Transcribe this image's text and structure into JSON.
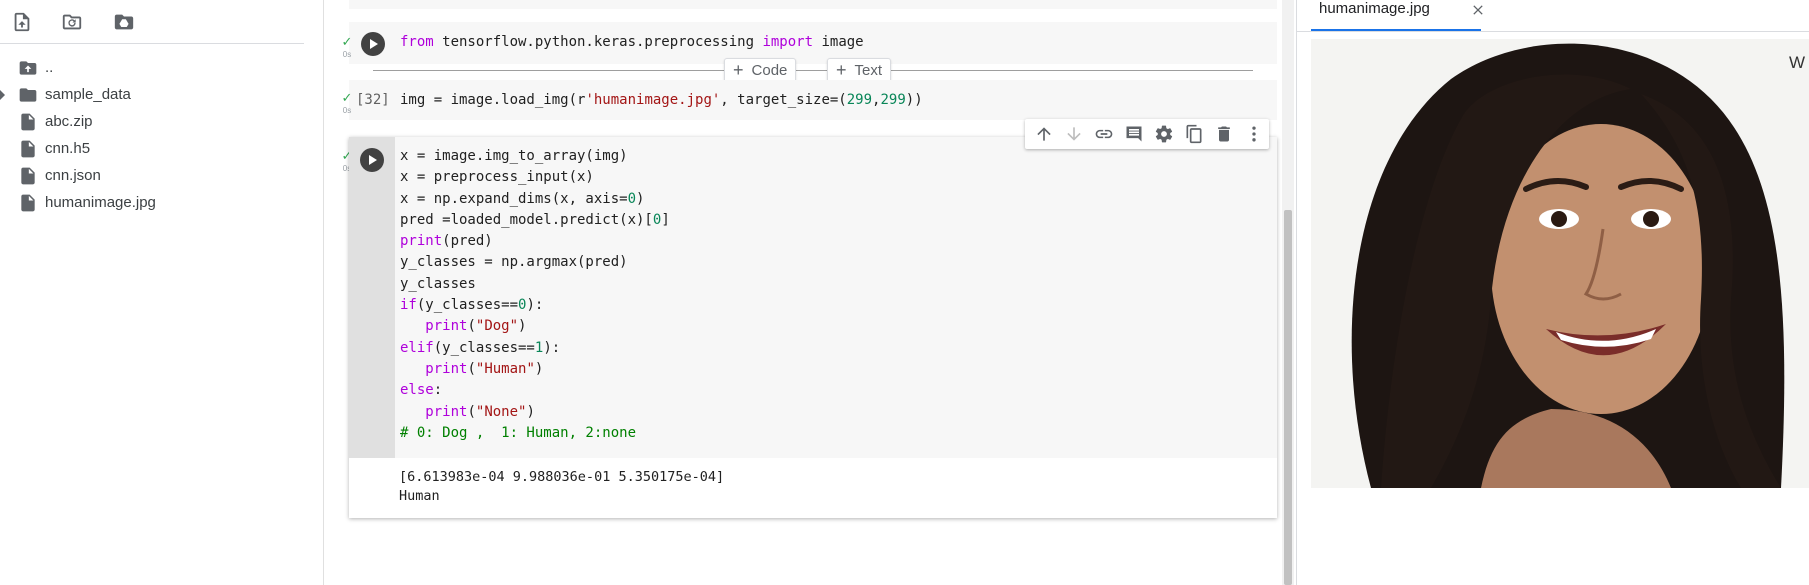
{
  "file_browser": {
    "toolbar": {
      "upload_icon": "upload-file-icon",
      "refresh_icon": "refresh-folder-icon",
      "mount_drive_icon": "mount-drive-icon"
    },
    "items": [
      {
        "label": "..",
        "icon": "folder-up-icon"
      },
      {
        "label": "sample_data",
        "icon": "folder-icon"
      },
      {
        "label": "abc.zip",
        "icon": "file-icon"
      },
      {
        "label": "cnn.h5",
        "icon": "file-icon"
      },
      {
        "label": "cnn.json",
        "icon": "file-icon"
      },
      {
        "label": "humanimage.jpg",
        "icon": "file-icon"
      }
    ]
  },
  "notebook": {
    "cells": [
      {
        "status": "✓",
        "duration": "0s",
        "exec_count": "",
        "code": "from tensorflow.python.keras.preprocessing import image"
      },
      {
        "status": "✓",
        "duration": "0s",
        "exec_count": "[32]",
        "code": "img = image.load_img(r'humanimage.jpg', target_size=(299,299))"
      },
      {
        "status": "✓",
        "duration": "0s",
        "exec_count": "",
        "code_lines": [
          "x = image.img_to_array(img)",
          "x = preprocess_input(x)",
          "x = np.expand_dims(x, axis=0)",
          "pred =loaded_model.predict(x)[0]",
          "print(pred)",
          "y_classes = np.argmax(pred)",
          "y_classes",
          "if(y_classes==0):",
          "   print(\"Dog\")",
          "elif(y_classes==1):",
          "   print(\"Human\")",
          "else:",
          "   print(\"None\")",
          "# 0: Dog ,  1: Human, 2:none"
        ],
        "output_lines": [
          "[6.613983e-04 9.988036e-01 5.350175e-04]",
          "Human"
        ]
      }
    ],
    "add_code_label": "Code",
    "add_text_label": "Text",
    "cell_toolbar": [
      "move-up-icon",
      "move-down-icon",
      "link-icon",
      "comment-icon",
      "settings-icon",
      "mirror-cell-icon",
      "delete-icon",
      "more-icon"
    ]
  },
  "viewer": {
    "tab_label": "humanimage.jpg",
    "photo_text": "W"
  },
  "colors": {
    "accent": "#1a73e8",
    "success": "#34a853",
    "keyword": "#af00db",
    "string": "#a31515",
    "number": "#098658",
    "comment": "#008000"
  }
}
